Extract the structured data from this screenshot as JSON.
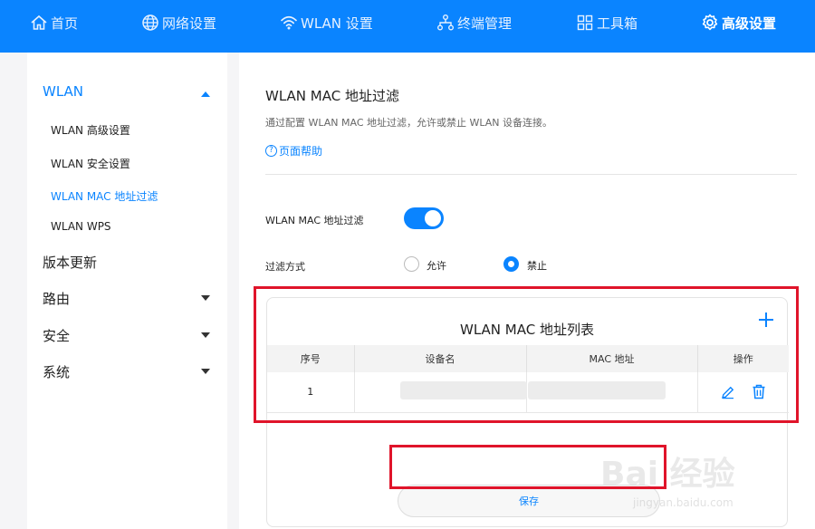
{
  "nav": {
    "items": [
      {
        "label": "首页",
        "icon": "home-icon"
      },
      {
        "label": "网络设置",
        "icon": "globe-icon"
      },
      {
        "label": "WLAN 设置",
        "icon": "wifi-icon"
      },
      {
        "label": "终端管理",
        "icon": "network-tree-icon"
      },
      {
        "label": "工具箱",
        "icon": "toolbox-grid-icon"
      },
      {
        "label": "高级设置",
        "icon": "gear-icon",
        "active": true
      }
    ]
  },
  "sidebar": {
    "groups": [
      {
        "label": "WLAN",
        "expanded": true,
        "active": true
      },
      {
        "label": "版本更新"
      },
      {
        "label": "路由"
      },
      {
        "label": "安全"
      },
      {
        "label": "系统"
      }
    ],
    "wlan_items": [
      {
        "label": "WLAN 高级设置"
      },
      {
        "label": "WLAN 安全设置"
      },
      {
        "label": "WLAN MAC 地址过滤",
        "active": true
      },
      {
        "label": "WLAN WPS"
      }
    ]
  },
  "main": {
    "title": "WLAN MAC 地址过滤",
    "description": "通过配置 WLAN MAC 地址过滤，允许或禁止 WLAN 设备连接。",
    "help_link": "页面帮助",
    "filter_toggle_label": "WLAN MAC 地址过滤",
    "filter_enabled": true,
    "filter_mode_label": "过滤方式",
    "filter_mode_options": [
      "允许",
      "禁止"
    ],
    "filter_mode_selected": "禁止"
  },
  "mac_list": {
    "title": "WLAN MAC 地址列表",
    "columns": [
      "序号",
      "设备名",
      "MAC 地址",
      "操作"
    ],
    "rows": [
      {
        "index": "1",
        "device_name": "",
        "mac": ""
      }
    ],
    "save_label": "保存"
  },
  "watermark": {
    "brand": "Bai 经验",
    "url": "jingyan.baidu.com"
  },
  "colors": {
    "accent": "#0a84ff",
    "highlight": "#e0142a"
  }
}
